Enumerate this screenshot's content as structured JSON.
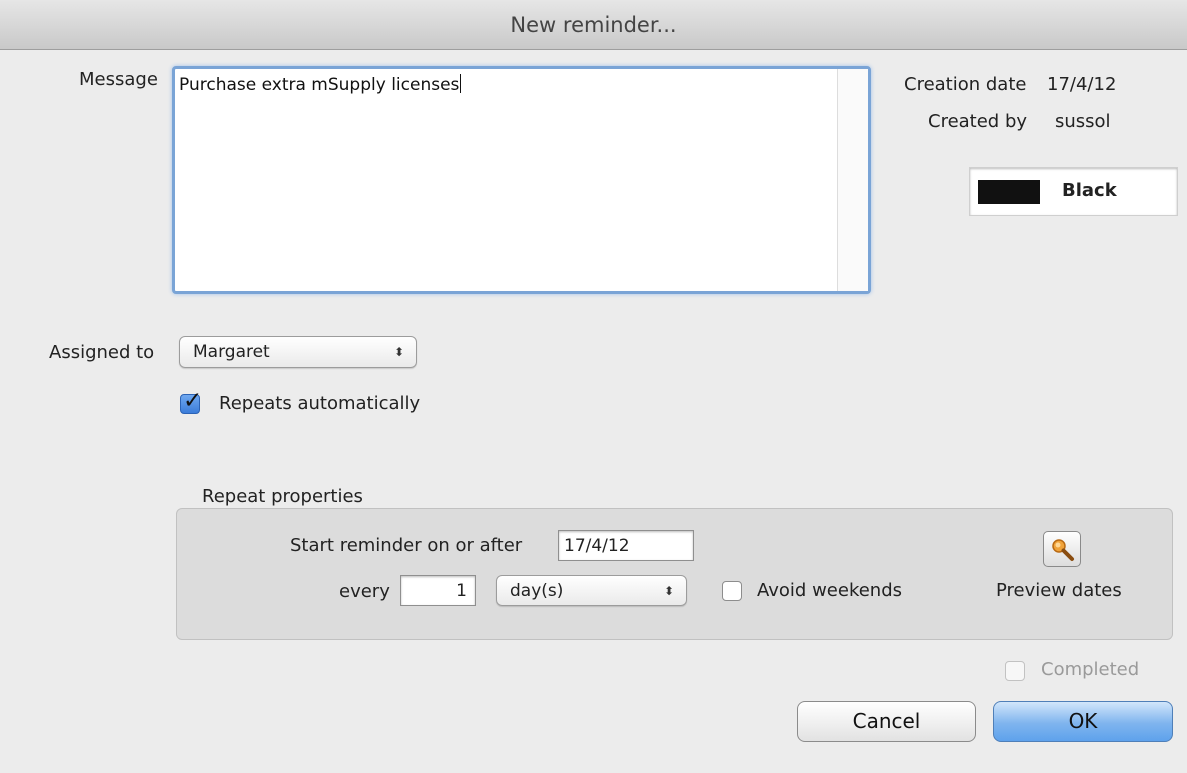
{
  "window": {
    "title": "New reminder..."
  },
  "message": {
    "label": "Message",
    "value": "Purchase extra mSupply licenses"
  },
  "info": {
    "creation_date_label": "Creation date",
    "creation_date": "17/4/12",
    "created_by_label": "Created by",
    "created_by": "sussol"
  },
  "color": {
    "name": "Black",
    "swatch": "#111111"
  },
  "assigned": {
    "label": "Assigned to",
    "value": "Margaret"
  },
  "repeats": {
    "label": "Repeats automatically",
    "checked": true
  },
  "repeat_props": {
    "title": "Repeat properties",
    "start_label": "Start reminder on or  after",
    "start_value": "17/4/12",
    "every_label": "every",
    "every_value": "1",
    "unit_value": "day(s)",
    "avoid_weekends_label": "Avoid weekends",
    "avoid_weekends_checked": false,
    "preview_label": "Preview dates"
  },
  "completed": {
    "label": "Completed",
    "checked": false,
    "disabled": true
  },
  "buttons": {
    "cancel": "Cancel",
    "ok": "OK"
  }
}
